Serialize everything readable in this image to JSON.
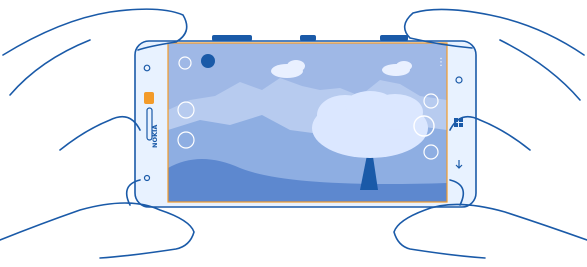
{
  "phone": {
    "brand": "NOKIA",
    "nav_icons": [
      "search-icon",
      "windows-icon",
      "back-icon"
    ]
  },
  "camera_app": {
    "left_controls": [
      "lens-icon",
      "flash-icon",
      "settings-icon"
    ],
    "right_controls": [
      "video-icon",
      "camera-shutter-icon",
      "switch-camera-icon"
    ],
    "menu_dots": "⋮"
  },
  "colors": {
    "outline": "#1a5aa8",
    "phone_body": "#e8f2ff",
    "screen_sky": "#9fb8e6",
    "screen_far_hills": "#b7cbef",
    "screen_mid": "#8eaee2",
    "screen_grass": "#5d88cf",
    "tree": "#dbe7ff",
    "accent_orange": "#f39b2a"
  }
}
